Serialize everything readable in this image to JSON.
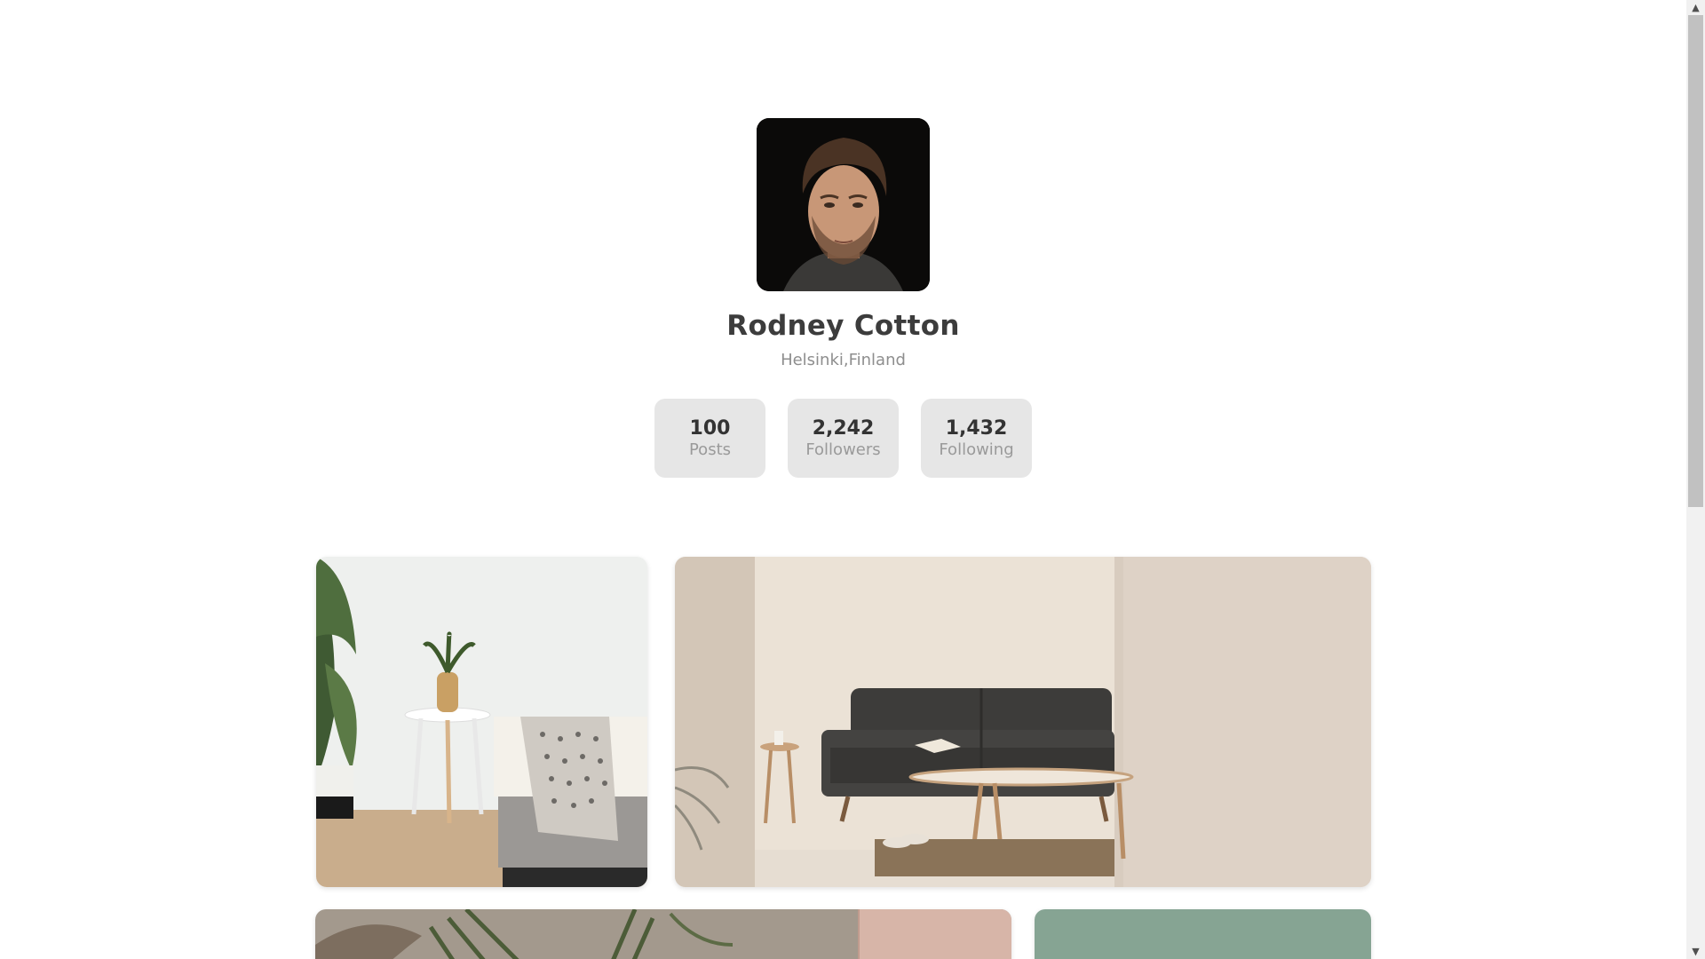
{
  "profile": {
    "name": "Rodney Cotton",
    "location": "Helsinki,Finland",
    "avatar_icon": "profile-photo"
  },
  "stats": [
    {
      "value": "100",
      "label": "Posts"
    },
    {
      "value": "2,242",
      "label": "Followers"
    },
    {
      "value": "1,432",
      "label": "Following"
    }
  ],
  "gallery": {
    "photos": [
      {
        "subject": "bedroom with plant and side table"
      },
      {
        "subject": "living room with dark sofa and coffee table"
      },
      {
        "subject": "textured wall with palm plant"
      },
      {
        "subject": "sage green wall"
      }
    ]
  },
  "scrollbar": {
    "up_icon": "chevron-up-icon",
    "down_icon": "chevron-down-icon"
  }
}
